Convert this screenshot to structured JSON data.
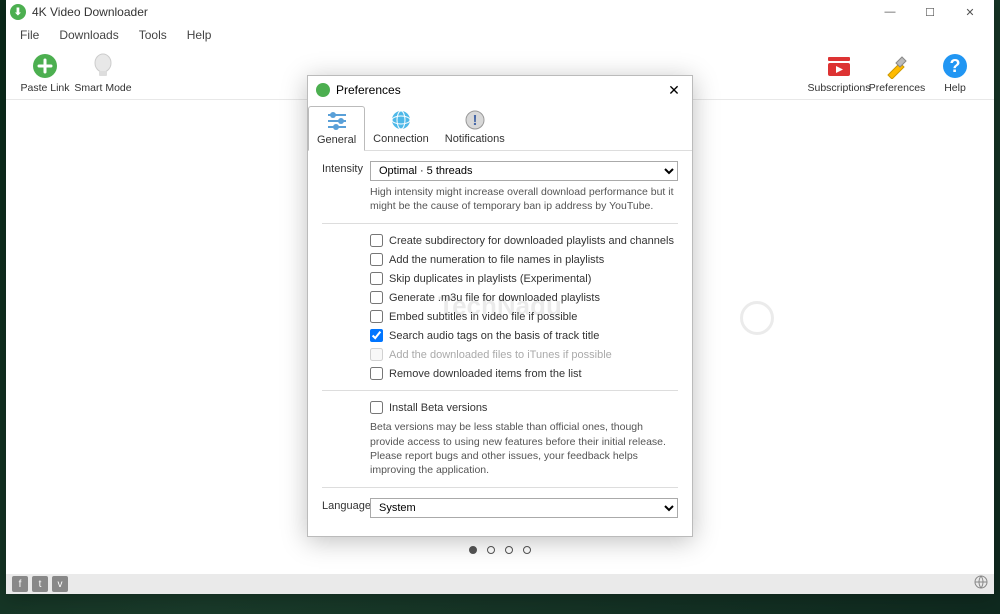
{
  "window": {
    "title": "4K Video Downloader",
    "controls": {
      "min": "—",
      "max": "☐",
      "close": "✕"
    }
  },
  "menu": {
    "file": "File",
    "downloads": "Downloads",
    "tools": "Tools",
    "help": "Help"
  },
  "toolbar": {
    "paste": "Paste Link",
    "smart": "Smart Mode",
    "subs": "Subscriptions",
    "prefs": "Preferences",
    "help": "Help"
  },
  "dialog": {
    "title": "Preferences",
    "close": "✕",
    "tabs": {
      "general": "General",
      "connection": "Connection",
      "notifications": "Notifications"
    },
    "intensity_label": "Intensity",
    "intensity_value": "Optimal · 5 threads",
    "intensity_hint": "High intensity might increase overall download performance but it might be the cause of temporary ban ip address by YouTube.",
    "checks": [
      {
        "label": "Create subdirectory for downloaded playlists and channels",
        "checked": false,
        "disabled": false
      },
      {
        "label": "Add the numeration to file names in playlists",
        "checked": false,
        "disabled": false
      },
      {
        "label": "Skip duplicates in playlists (Experimental)",
        "checked": false,
        "disabled": false
      },
      {
        "label": "Generate .m3u file for downloaded playlists",
        "checked": false,
        "disabled": false
      },
      {
        "label": "Embed subtitles in video file if possible",
        "checked": false,
        "disabled": false
      },
      {
        "label": "Search audio tags on the basis of track title",
        "checked": true,
        "disabled": false
      },
      {
        "label": "Add the downloaded files to iTunes if possible",
        "checked": false,
        "disabled": true
      },
      {
        "label": "Remove downloaded items from the list",
        "checked": false,
        "disabled": false
      }
    ],
    "beta_label": "Install Beta versions",
    "beta_hint": "Beta versions may be less stable than official ones, though provide access to using new features before their initial release. Please report bugs and other issues, your feedback helps improving the application.",
    "language_label": "Language",
    "language_value": "System"
  },
  "watermark": "TechNadu"
}
